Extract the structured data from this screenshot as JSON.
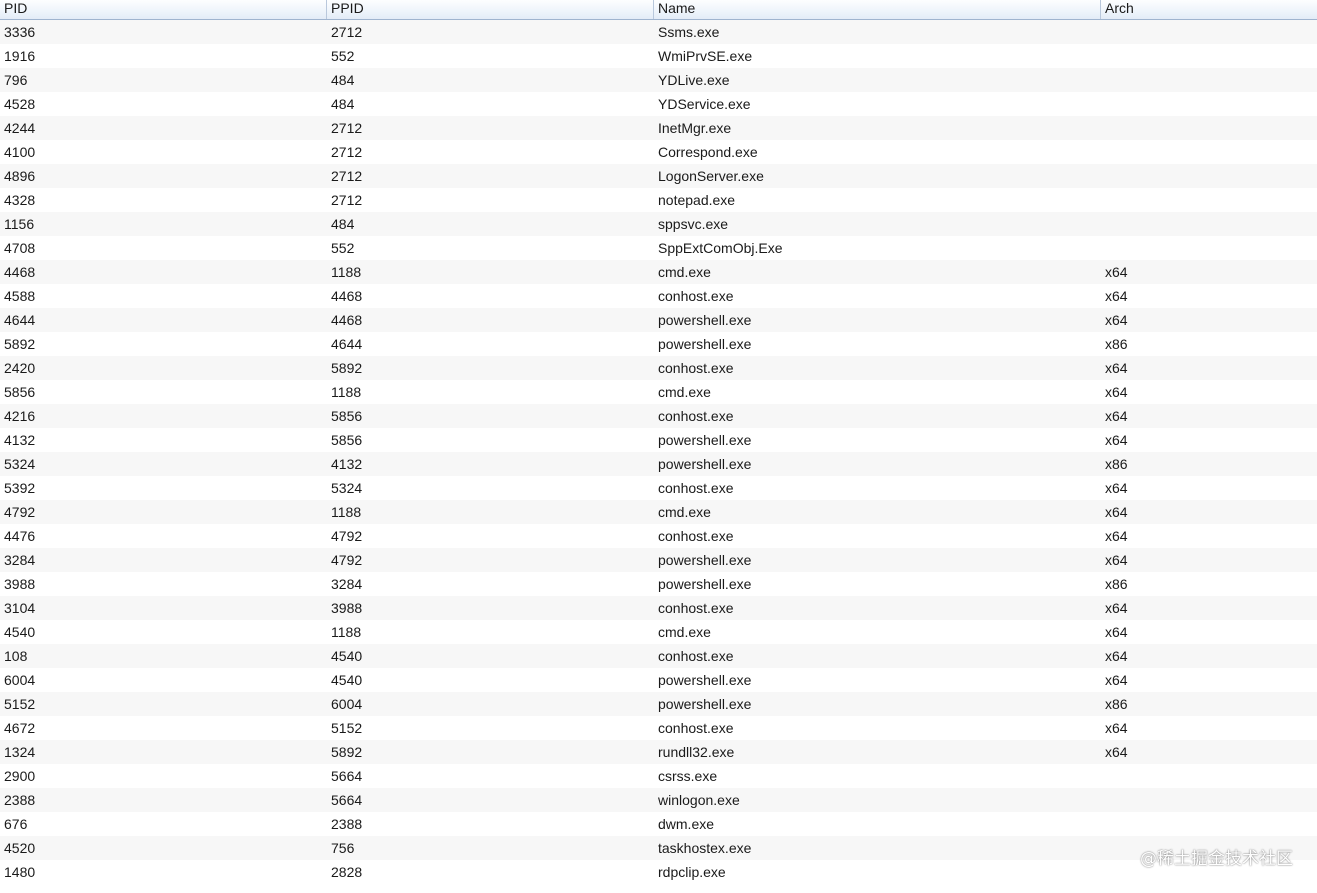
{
  "table": {
    "columns": [
      "PID",
      "PPID",
      "Name",
      "Arch"
    ],
    "rows": [
      [
        "3336",
        "2712",
        "Ssms.exe",
        ""
      ],
      [
        "1916",
        "552",
        "WmiPrvSE.exe",
        ""
      ],
      [
        "796",
        "484",
        "YDLive.exe",
        ""
      ],
      [
        "4528",
        "484",
        "YDService.exe",
        ""
      ],
      [
        "4244",
        "2712",
        "InetMgr.exe",
        ""
      ],
      [
        "4100",
        "2712",
        "Correspond.exe",
        ""
      ],
      [
        "4896",
        "2712",
        "LogonServer.exe",
        ""
      ],
      [
        "4328",
        "2712",
        "notepad.exe",
        ""
      ],
      [
        "1156",
        "484",
        "sppsvc.exe",
        ""
      ],
      [
        "4708",
        "552",
        "SppExtComObj.Exe",
        ""
      ],
      [
        "4468",
        "1188",
        "cmd.exe",
        "x64"
      ],
      [
        "4588",
        "4468",
        "conhost.exe",
        "x64"
      ],
      [
        "4644",
        "4468",
        "powershell.exe",
        "x64"
      ],
      [
        "5892",
        "4644",
        "powershell.exe",
        "x86"
      ],
      [
        "2420",
        "5892",
        "conhost.exe",
        "x64"
      ],
      [
        "5856",
        "1188",
        "cmd.exe",
        "x64"
      ],
      [
        "4216",
        "5856",
        "conhost.exe",
        "x64"
      ],
      [
        "4132",
        "5856",
        "powershell.exe",
        "x64"
      ],
      [
        "5324",
        "4132",
        "powershell.exe",
        "x86"
      ],
      [
        "5392",
        "5324",
        "conhost.exe",
        "x64"
      ],
      [
        "4792",
        "1188",
        "cmd.exe",
        "x64"
      ],
      [
        "4476",
        "4792",
        "conhost.exe",
        "x64"
      ],
      [
        "3284",
        "4792",
        "powershell.exe",
        "x64"
      ],
      [
        "3988",
        "3284",
        "powershell.exe",
        "x86"
      ],
      [
        "3104",
        "3988",
        "conhost.exe",
        "x64"
      ],
      [
        "4540",
        "1188",
        "cmd.exe",
        "x64"
      ],
      [
        "108",
        "4540",
        "conhost.exe",
        "x64"
      ],
      [
        "6004",
        "4540",
        "powershell.exe",
        "x64"
      ],
      [
        "5152",
        "6004",
        "powershell.exe",
        "x86"
      ],
      [
        "4672",
        "5152",
        "conhost.exe",
        "x64"
      ],
      [
        "1324",
        "5892",
        "rundll32.exe",
        "x64"
      ],
      [
        "2900",
        "5664",
        "csrss.exe",
        ""
      ],
      [
        "2388",
        "5664",
        "winlogon.exe",
        ""
      ],
      [
        "676",
        "2388",
        "dwm.exe",
        ""
      ],
      [
        "4520",
        "756",
        "taskhostex.exe",
        ""
      ],
      [
        "1480",
        "2828",
        "rdpclip.exe",
        ""
      ]
    ]
  },
  "watermark": "@稀土掘金技术社区",
  "colors": {
    "header_bg": "#eef4fb",
    "header_border": "#9fb4cf",
    "row_alt": "#f7f7f7",
    "row": "#ffffff",
    "text": "#1a1a1a"
  }
}
